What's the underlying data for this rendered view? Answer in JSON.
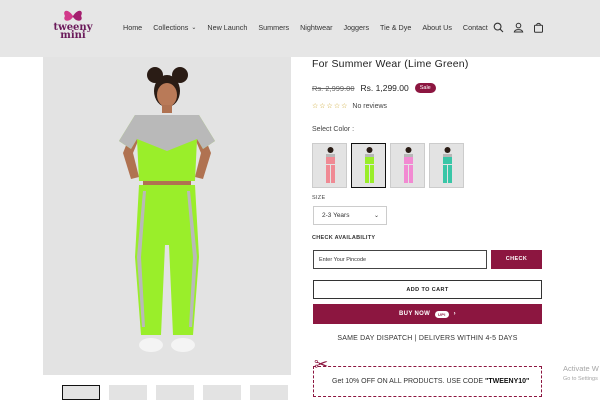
{
  "header": {
    "logo_line1": "tweeny",
    "logo_line2": "mini",
    "nav": [
      {
        "label": "Home"
      },
      {
        "label": "Collections",
        "dropdown": true
      },
      {
        "label": "New Launch"
      },
      {
        "label": "Summers"
      },
      {
        "label": "Nightwear"
      },
      {
        "label": "Joggers"
      },
      {
        "label": "Tie & Dye"
      },
      {
        "label": "About Us"
      },
      {
        "label": "Contact"
      }
    ],
    "icons": [
      "search-icon",
      "account-icon",
      "cart-icon"
    ]
  },
  "product": {
    "title_line2": "For Summer Wear (Lime Green)",
    "old_price": "Rs. 2,999.00",
    "price": "Rs. 1,299.00",
    "sale_badge": "Sale",
    "rating_stars": 0,
    "reviews_text": "No reviews",
    "color_label": "Select Color :",
    "colors": [
      {
        "name": "pink",
        "top": "#f08a94",
        "bottom": "#f08a94",
        "accent": "#b7b7b7"
      },
      {
        "name": "lime-green",
        "top": "#9aee2a",
        "bottom": "#9aee2a",
        "accent": "#b7b7b7",
        "selected": true
      },
      {
        "name": "light-pink",
        "top": "#f28ad2",
        "bottom": "#f28ad2",
        "accent": "#b7b7b7"
      },
      {
        "name": "teal",
        "top": "#39c6a7",
        "bottom": "#39c6a7",
        "accent": "#b7b7b7"
      }
    ],
    "size_label": "SIZE",
    "size_value": "2-3 Years",
    "availability_label": "CHECK AVAILABILITY",
    "pincode_placeholder": "Enter Your Pincode",
    "check_label": "CHECK",
    "add_to_cart_label": "ADD TO CART",
    "buy_now_label": "BUY NOW",
    "buy_now_pill": "UPI",
    "dispatch_text": "SAME DAY DISPATCH | DELIVERS WITHIN 4-5 DAYS",
    "coupon_prefix": "Get 10% OFF ON ALL PRODUCTS. USE CODE ",
    "coupon_code": "\"TWEENY10\"",
    "thumbnail_count": 5
  },
  "colors": {
    "brand": "#8c1640",
    "header_bg": "#e6e6e6",
    "image_bg": "#e3e3e3",
    "lime": "#9aee2a"
  },
  "os_watermark": {
    "line1": "Activate W",
    "line2": "Go to Settings"
  }
}
